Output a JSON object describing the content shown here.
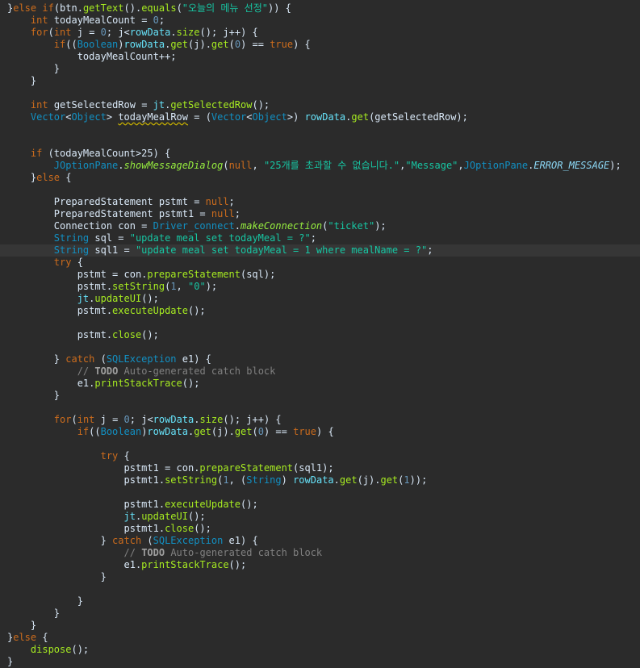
{
  "editor": {
    "current_line_index": 20,
    "lines": [
      [
        [
          "plain",
          "}"
        ],
        [
          "kw",
          "else if"
        ],
        [
          "plain",
          "(btn."
        ],
        [
          "method",
          "getText"
        ],
        [
          "plain",
          "()."
        ],
        [
          "method",
          "equals"
        ],
        [
          "plain",
          "("
        ],
        [
          "str",
          "\"오늘의 메뉴 선정\""
        ],
        [
          "plain",
          ")) {"
        ]
      ],
      [
        [
          "plain",
          "    "
        ],
        [
          "kw",
          "int"
        ],
        [
          "plain",
          " todayMealCount = "
        ],
        [
          "num",
          "0"
        ],
        [
          "plain",
          ";"
        ]
      ],
      [
        [
          "plain",
          "    "
        ],
        [
          "kw",
          "for"
        ],
        [
          "plain",
          "("
        ],
        [
          "kw",
          "int"
        ],
        [
          "plain",
          " j = "
        ],
        [
          "num",
          "0"
        ],
        [
          "plain",
          "; j<"
        ],
        [
          "field",
          "rowData"
        ],
        [
          "plain",
          "."
        ],
        [
          "method",
          "size"
        ],
        [
          "plain",
          "(); j++) {"
        ]
      ],
      [
        [
          "plain",
          "        "
        ],
        [
          "kw",
          "if"
        ],
        [
          "plain",
          "(("
        ],
        [
          "type",
          "Boolean"
        ],
        [
          "plain",
          ")"
        ],
        [
          "field",
          "rowData"
        ],
        [
          "plain",
          "."
        ],
        [
          "method",
          "get"
        ],
        [
          "plain",
          "(j)."
        ],
        [
          "method",
          "get"
        ],
        [
          "plain",
          "("
        ],
        [
          "num",
          "0"
        ],
        [
          "plain",
          ") == "
        ],
        [
          "kw",
          "true"
        ],
        [
          "plain",
          ") {"
        ]
      ],
      [
        [
          "plain",
          "            todayMealCount++;"
        ]
      ],
      [
        [
          "plain",
          "        }"
        ]
      ],
      [
        [
          "plain",
          "    }"
        ]
      ],
      [
        [
          "plain",
          ""
        ]
      ],
      [
        [
          "plain",
          "    "
        ],
        [
          "kw",
          "int"
        ],
        [
          "plain",
          " getSelectedRow = "
        ],
        [
          "field",
          "jt"
        ],
        [
          "plain",
          "."
        ],
        [
          "method",
          "getSelectedRow"
        ],
        [
          "plain",
          "();"
        ]
      ],
      [
        [
          "plain",
          "    "
        ],
        [
          "type",
          "Vector"
        ],
        [
          "plain",
          "<"
        ],
        [
          "type",
          "Object"
        ],
        [
          "plain",
          "> "
        ],
        [
          "warn",
          "todayMealRow"
        ],
        [
          "plain",
          " = ("
        ],
        [
          "type",
          "Vector"
        ],
        [
          "plain",
          "<"
        ],
        [
          "type",
          "Object"
        ],
        [
          "plain",
          ">) "
        ],
        [
          "field",
          "rowData"
        ],
        [
          "plain",
          "."
        ],
        [
          "method",
          "get"
        ],
        [
          "plain",
          "(getSelectedRow);"
        ]
      ],
      [
        [
          "plain",
          ""
        ]
      ],
      [
        [
          "plain",
          ""
        ]
      ],
      [
        [
          "plain",
          "    "
        ],
        [
          "kw",
          "if"
        ],
        [
          "plain",
          " (todayMealCount>25) {"
        ]
      ],
      [
        [
          "plain",
          "        "
        ],
        [
          "type",
          "JOptionPane"
        ],
        [
          "plain",
          "."
        ],
        [
          "static",
          "showMessageDialog"
        ],
        [
          "plain",
          "("
        ],
        [
          "kw",
          "null"
        ],
        [
          "plain",
          ", "
        ],
        [
          "str",
          "\"25개를 초과할 수 없습니다.\""
        ],
        [
          "plain",
          ","
        ],
        [
          "str",
          "\"Message\""
        ],
        [
          "plain",
          ","
        ],
        [
          "type",
          "JOptionPane"
        ],
        [
          "plain",
          "."
        ],
        [
          "sfield",
          "ERROR_MESSAGE"
        ],
        [
          "plain",
          ");"
        ]
      ],
      [
        [
          "plain",
          "    }"
        ],
        [
          "kw",
          "else"
        ],
        [
          "plain",
          " {"
        ]
      ],
      [
        [
          "plain",
          ""
        ]
      ],
      [
        [
          "plain",
          "        PreparedStatement pstmt = "
        ],
        [
          "kw",
          "null"
        ],
        [
          "plain",
          ";"
        ]
      ],
      [
        [
          "plain",
          "        PreparedStatement pstmt1 = "
        ],
        [
          "kw",
          "null"
        ],
        [
          "plain",
          ";"
        ]
      ],
      [
        [
          "plain",
          "        Connection con = "
        ],
        [
          "type",
          "Driver_connect"
        ],
        [
          "plain",
          "."
        ],
        [
          "static",
          "makeConnection"
        ],
        [
          "plain",
          "("
        ],
        [
          "str",
          "\"ticket\""
        ],
        [
          "plain",
          ");"
        ]
      ],
      [
        [
          "plain",
          "        "
        ],
        [
          "type",
          "String"
        ],
        [
          "plain",
          " sql = "
        ],
        [
          "str",
          "\"update meal set todayMeal = ?\""
        ],
        [
          "plain",
          ";"
        ]
      ],
      [
        [
          "plain",
          "        "
        ],
        [
          "type",
          "String"
        ],
        [
          "plain",
          " sql1 = "
        ],
        [
          "str",
          "\"update meal set todayMeal = 1 where mealName = ?\""
        ],
        [
          "plain",
          ";"
        ]
      ],
      [
        [
          "plain",
          "        "
        ],
        [
          "kw",
          "try"
        ],
        [
          "plain",
          " {"
        ]
      ],
      [
        [
          "plain",
          "            pstmt = con."
        ],
        [
          "method",
          "prepareStatement"
        ],
        [
          "plain",
          "(sql);"
        ]
      ],
      [
        [
          "plain",
          "            pstmt."
        ],
        [
          "method",
          "setString"
        ],
        [
          "plain",
          "("
        ],
        [
          "num",
          "1"
        ],
        [
          "plain",
          ", "
        ],
        [
          "str",
          "\"0\""
        ],
        [
          "plain",
          ");"
        ]
      ],
      [
        [
          "plain",
          "            "
        ],
        [
          "field",
          "jt"
        ],
        [
          "plain",
          "."
        ],
        [
          "method",
          "updateUI"
        ],
        [
          "plain",
          "();"
        ]
      ],
      [
        [
          "plain",
          "            pstmt."
        ],
        [
          "method",
          "executeUpdate"
        ],
        [
          "plain",
          "();"
        ]
      ],
      [
        [
          "plain",
          ""
        ]
      ],
      [
        [
          "plain",
          "            pstmt."
        ],
        [
          "method",
          "close"
        ],
        [
          "plain",
          "();"
        ]
      ],
      [
        [
          "plain",
          ""
        ]
      ],
      [
        [
          "plain",
          "        } "
        ],
        [
          "kw",
          "catch"
        ],
        [
          "plain",
          " ("
        ],
        [
          "type",
          "SQLException"
        ],
        [
          "plain",
          " e1) {"
        ]
      ],
      [
        [
          "plain",
          "            "
        ],
        [
          "cmt",
          "// "
        ],
        [
          "todo",
          "TODO"
        ],
        [
          "cmt",
          " Auto-generated catch block"
        ]
      ],
      [
        [
          "plain",
          "            e1."
        ],
        [
          "method",
          "printStackTrace"
        ],
        [
          "plain",
          "();"
        ]
      ],
      [
        [
          "plain",
          "        }"
        ]
      ],
      [
        [
          "plain",
          ""
        ]
      ],
      [
        [
          "plain",
          "        "
        ],
        [
          "kw",
          "for"
        ],
        [
          "plain",
          "("
        ],
        [
          "kw",
          "int"
        ],
        [
          "plain",
          " j = "
        ],
        [
          "num",
          "0"
        ],
        [
          "plain",
          "; j<"
        ],
        [
          "field",
          "rowData"
        ],
        [
          "plain",
          "."
        ],
        [
          "method",
          "size"
        ],
        [
          "plain",
          "(); j++) {"
        ]
      ],
      [
        [
          "plain",
          "            "
        ],
        [
          "kw",
          "if"
        ],
        [
          "plain",
          "(("
        ],
        [
          "type",
          "Boolean"
        ],
        [
          "plain",
          ")"
        ],
        [
          "field",
          "rowData"
        ],
        [
          "plain",
          "."
        ],
        [
          "method",
          "get"
        ],
        [
          "plain",
          "(j)."
        ],
        [
          "method",
          "get"
        ],
        [
          "plain",
          "("
        ],
        [
          "num",
          "0"
        ],
        [
          "plain",
          ") == "
        ],
        [
          "kw",
          "true"
        ],
        [
          "plain",
          ") {"
        ]
      ],
      [
        [
          "plain",
          ""
        ]
      ],
      [
        [
          "plain",
          "                "
        ],
        [
          "kw",
          "try"
        ],
        [
          "plain",
          " {"
        ]
      ],
      [
        [
          "plain",
          "                    pstmt1 = con."
        ],
        [
          "method",
          "prepareStatement"
        ],
        [
          "plain",
          "(sql1);"
        ]
      ],
      [
        [
          "plain",
          "                    pstmt1."
        ],
        [
          "method",
          "setString"
        ],
        [
          "plain",
          "("
        ],
        [
          "num",
          "1"
        ],
        [
          "plain",
          ", ("
        ],
        [
          "type",
          "String"
        ],
        [
          "plain",
          ") "
        ],
        [
          "field",
          "rowData"
        ],
        [
          "plain",
          "."
        ],
        [
          "method",
          "get"
        ],
        [
          "plain",
          "(j)."
        ],
        [
          "method",
          "get"
        ],
        [
          "plain",
          "("
        ],
        [
          "num",
          "1"
        ],
        [
          "plain",
          "));"
        ]
      ],
      [
        [
          "plain",
          ""
        ]
      ],
      [
        [
          "plain",
          "                    pstmt1."
        ],
        [
          "method",
          "executeUpdate"
        ],
        [
          "plain",
          "();"
        ]
      ],
      [
        [
          "plain",
          "                    "
        ],
        [
          "field",
          "jt"
        ],
        [
          "plain",
          "."
        ],
        [
          "method",
          "updateUI"
        ],
        [
          "plain",
          "();"
        ]
      ],
      [
        [
          "plain",
          "                    pstmt1."
        ],
        [
          "method",
          "close"
        ],
        [
          "plain",
          "();"
        ]
      ],
      [
        [
          "plain",
          "                } "
        ],
        [
          "kw",
          "catch"
        ],
        [
          "plain",
          " ("
        ],
        [
          "type",
          "SQLException"
        ],
        [
          "plain",
          " e1) {"
        ]
      ],
      [
        [
          "plain",
          "                    "
        ],
        [
          "cmt",
          "// "
        ],
        [
          "todo",
          "TODO"
        ],
        [
          "cmt",
          " Auto-generated catch block"
        ]
      ],
      [
        [
          "plain",
          "                    e1."
        ],
        [
          "method",
          "printStackTrace"
        ],
        [
          "plain",
          "();"
        ]
      ],
      [
        [
          "plain",
          "                }"
        ]
      ],
      [
        [
          "plain",
          ""
        ]
      ],
      [
        [
          "plain",
          "            }"
        ]
      ],
      [
        [
          "plain",
          "        }"
        ]
      ],
      [
        [
          "plain",
          "    }"
        ]
      ],
      [
        [
          "plain",
          "}"
        ],
        [
          "kw",
          "else"
        ],
        [
          "plain",
          " {"
        ]
      ],
      [
        [
          "plain",
          "    "
        ],
        [
          "method",
          "dispose"
        ],
        [
          "plain",
          "();"
        ]
      ],
      [
        [
          "plain",
          "}"
        ]
      ]
    ]
  }
}
